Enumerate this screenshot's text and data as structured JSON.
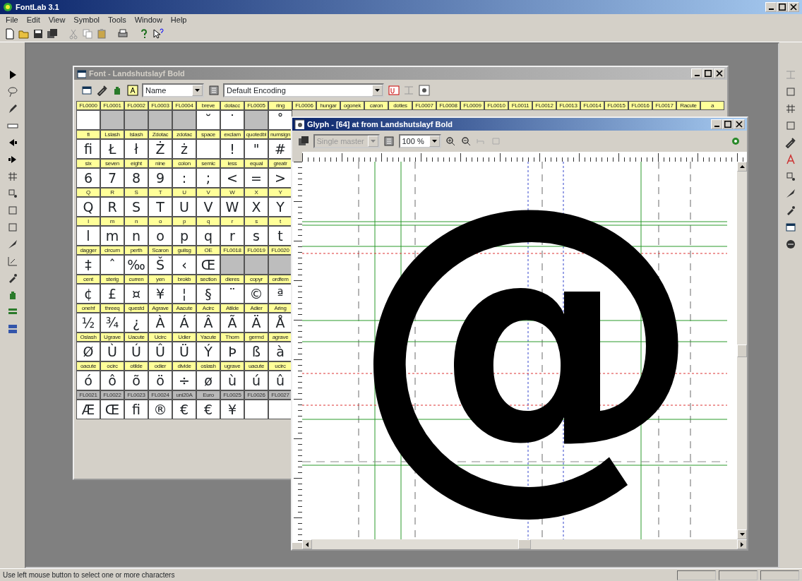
{
  "app": {
    "title": "FontLab 3.1",
    "menu": [
      "File",
      "Edit",
      "View",
      "Symbol",
      "Tools",
      "Window",
      "Help"
    ]
  },
  "font_window": {
    "title": "Font - Landshutslayf Bold",
    "name_mode": "Name",
    "encoding": "Default Encoding",
    "top_labels": [
      "FL0000",
      "FL0001",
      "FL0002",
      "FL0003",
      "FL0004",
      "breve",
      "dotacc",
      "FL0005",
      "ring",
      "FL0006",
      "hungar",
      "ogonek",
      "caron",
      "dotles",
      "FL0007",
      "FL0008",
      "FL0009",
      "FL0010",
      "FL0011",
      "FL0012",
      "FL0013",
      "FL0014",
      "FL0015",
      "FL0016",
      "FL0017",
      "Racute",
      "a"
    ],
    "rows": [
      {
        "marked": false,
        "cells": [
          {
            "empty": false
          },
          {
            "empty": true
          },
          {
            "empty": true
          },
          {
            "empty": true
          },
          {
            "empty": true
          },
          {
            "glyph": "˘",
            "empty": false
          },
          {
            "glyph": "˙",
            "empty": false
          },
          {
            "empty": true
          },
          {
            "glyph": "˚",
            "empty": false
          }
        ]
      },
      {
        "marked": false,
        "cells": [
          {
            "name": "fi",
            "glyph": "ﬁ",
            "empty": false
          },
          {
            "name": "Lslash",
            "glyph": "Ł",
            "empty": false
          },
          {
            "name": "lslash",
            "glyph": "ł",
            "empty": false
          },
          {
            "name": "Zdotac",
            "glyph": "Ż",
            "empty": false
          },
          {
            "name": "zdotac",
            "glyph": "ż",
            "empty": false
          },
          {
            "name": "space",
            "empty": false
          },
          {
            "name": "exclam",
            "glyph": "!",
            "empty": false
          },
          {
            "name": "quotedbl",
            "glyph": "\"",
            "empty": false
          },
          {
            "name": "numsign",
            "glyph": "#",
            "empty": false
          }
        ]
      },
      {
        "marked": false,
        "cells": [
          {
            "name": "six",
            "glyph": "6",
            "empty": false
          },
          {
            "name": "seven",
            "glyph": "7",
            "empty": false
          },
          {
            "name": "eight",
            "glyph": "8",
            "empty": false
          },
          {
            "name": "nine",
            "glyph": "9",
            "empty": false
          },
          {
            "name": "colon",
            "glyph": ":",
            "empty": false
          },
          {
            "name": "semic",
            "glyph": ";",
            "empty": false
          },
          {
            "name": "less",
            "glyph": "<",
            "empty": false
          },
          {
            "name": "equal",
            "glyph": "=",
            "empty": false
          },
          {
            "name": "greatr",
            "glyph": ">",
            "empty": false
          }
        ]
      },
      {
        "marked": false,
        "cells": [
          {
            "name": "Q",
            "glyph": "Q",
            "empty": false
          },
          {
            "name": "R",
            "glyph": "R",
            "empty": false
          },
          {
            "name": "S",
            "glyph": "S",
            "empty": false
          },
          {
            "name": "T",
            "glyph": "T",
            "empty": false
          },
          {
            "name": "U",
            "glyph": "U",
            "empty": false
          },
          {
            "name": "V",
            "glyph": "V",
            "empty": false
          },
          {
            "name": "W",
            "glyph": "W",
            "empty": false
          },
          {
            "name": "X",
            "glyph": "X",
            "empty": false
          },
          {
            "name": "Y",
            "glyph": "Y",
            "empty": false
          }
        ]
      },
      {
        "marked": false,
        "cells": [
          {
            "name": "l",
            "glyph": "l",
            "empty": false
          },
          {
            "name": "m",
            "glyph": "m",
            "empty": false
          },
          {
            "name": "n",
            "glyph": "n",
            "empty": false
          },
          {
            "name": "o",
            "glyph": "o",
            "empty": false
          },
          {
            "name": "p",
            "glyph": "p",
            "empty": false
          },
          {
            "name": "q",
            "glyph": "q",
            "empty": false
          },
          {
            "name": "r",
            "glyph": "r",
            "empty": false
          },
          {
            "name": "s",
            "glyph": "s",
            "empty": false
          },
          {
            "name": "t",
            "glyph": "t",
            "empty": false
          }
        ]
      },
      {
        "marked": false,
        "cells": [
          {
            "name": "dagger",
            "glyph": "‡",
            "empty": false
          },
          {
            "name": "circum",
            "glyph": "ˆ",
            "empty": false
          },
          {
            "name": "perth",
            "glyph": "‰",
            "empty": false
          },
          {
            "name": "Scaron",
            "glyph": "Š",
            "empty": false
          },
          {
            "name": "guilsg",
            "glyph": "‹",
            "empty": false
          },
          {
            "name": "OE",
            "glyph": "Œ",
            "empty": false
          },
          {
            "name": "FL0018",
            "empty": true
          },
          {
            "name": "FL0019",
            "empty": true
          },
          {
            "name": "FL0020",
            "empty": true
          }
        ]
      },
      {
        "marked": false,
        "cells": [
          {
            "name": "cent",
            "glyph": "¢",
            "empty": false
          },
          {
            "name": "sterlg",
            "glyph": "£",
            "empty": false
          },
          {
            "name": "curren",
            "glyph": "¤",
            "empty": false
          },
          {
            "name": "yen",
            "glyph": "¥",
            "empty": false
          },
          {
            "name": "brokb",
            "glyph": "¦",
            "empty": false
          },
          {
            "name": "section",
            "glyph": "§",
            "empty": false
          },
          {
            "name": "dieres",
            "glyph": "¨",
            "empty": false
          },
          {
            "name": "copyr",
            "glyph": "©",
            "empty": false
          },
          {
            "name": "ordfem",
            "glyph": "ª",
            "empty": false
          }
        ]
      },
      {
        "marked": false,
        "cells": [
          {
            "name": "onehf",
            "glyph": "½",
            "empty": false
          },
          {
            "name": "threeq",
            "glyph": "¾",
            "empty": false
          },
          {
            "name": "questd",
            "glyph": "¿",
            "empty": false
          },
          {
            "name": "Agrave",
            "glyph": "À",
            "empty": false
          },
          {
            "name": "Aacute",
            "glyph": "Á",
            "empty": false
          },
          {
            "name": "Acirc",
            "glyph": "Â",
            "empty": false
          },
          {
            "name": "Atilde",
            "glyph": "Ã",
            "empty": false
          },
          {
            "name": "Adier",
            "glyph": "Ä",
            "empty": false
          },
          {
            "name": "Aring",
            "glyph": "Å",
            "empty": false
          }
        ]
      },
      {
        "marked": false,
        "cells": [
          {
            "name": "Oslash",
            "glyph": "Ø",
            "empty": false
          },
          {
            "name": "Ugrave",
            "glyph": "Ù",
            "empty": false
          },
          {
            "name": "Uacute",
            "glyph": "Ú",
            "empty": false
          },
          {
            "name": "Ucirc",
            "glyph": "Û",
            "empty": false
          },
          {
            "name": "Udier",
            "glyph": "Ü",
            "empty": false
          },
          {
            "name": "Yacute",
            "glyph": "Ý",
            "empty": false
          },
          {
            "name": "Thorn",
            "glyph": "Þ",
            "empty": false
          },
          {
            "name": "germd",
            "glyph": "ß",
            "empty": false
          },
          {
            "name": "agrave",
            "glyph": "à",
            "empty": false
          }
        ]
      },
      {
        "marked": false,
        "cells": [
          {
            "name": "oacute",
            "glyph": "ó",
            "empty": false
          },
          {
            "name": "ocirc",
            "glyph": "ô",
            "empty": false
          },
          {
            "name": "otilde",
            "glyph": "õ",
            "empty": false
          },
          {
            "name": "odier",
            "glyph": "ö",
            "empty": false
          },
          {
            "name": "divide",
            "glyph": "÷",
            "empty": false
          },
          {
            "name": "oslash",
            "glyph": "ø",
            "empty": false
          },
          {
            "name": "ugrave",
            "glyph": "ù",
            "empty": false
          },
          {
            "name": "uacute",
            "glyph": "ú",
            "empty": false
          },
          {
            "name": "ucirc",
            "glyph": "û",
            "empty": false
          }
        ]
      },
      {
        "marked": true,
        "cells": [
          {
            "name": "FL0021",
            "glyph": "Æ",
            "empty": false
          },
          {
            "name": "FL0022",
            "glyph": "Œ",
            "empty": false
          },
          {
            "name": "FL0023",
            "glyph": "ﬁ",
            "empty": false
          },
          {
            "name": "FL0024",
            "glyph": "®",
            "empty": false
          },
          {
            "name": "uni20A",
            "glyph": "€",
            "empty": false
          },
          {
            "name": "Euro",
            "glyph": "€",
            "empty": false
          },
          {
            "name": "FL0025",
            "glyph": "¥",
            "empty": false
          },
          {
            "name": "FL0026",
            "empty": false
          },
          {
            "name": "FL0027",
            "empty": false
          }
        ]
      }
    ]
  },
  "glyph_window": {
    "title": "Glyph - [64] at from Landshutslayf Bold",
    "master": {
      "value": "Single master",
      "disabled": true
    },
    "zoom": "100 %",
    "glyph": "@"
  },
  "status_bar": "Use left mouse button to select one or more characters"
}
